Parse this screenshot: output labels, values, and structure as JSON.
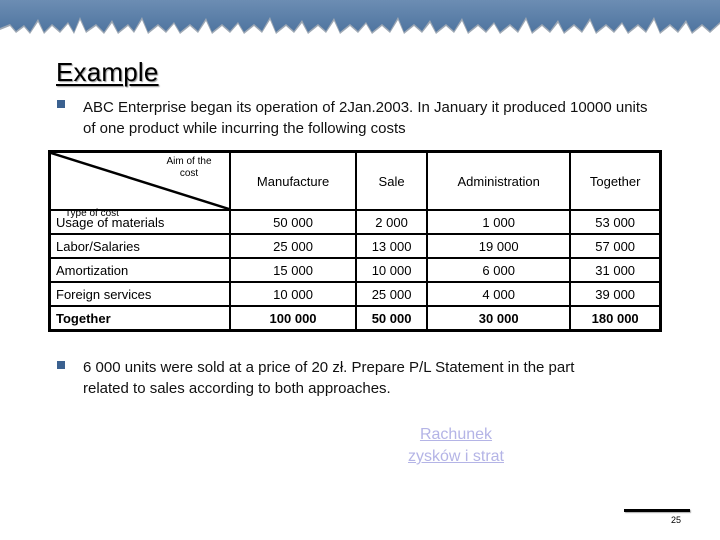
{
  "slide": {
    "title": "Example",
    "intro_text": "ABC Enterprise began its operation of 2Jan.2003. In January it produced 10000 units of one product while incurring the following costs",
    "table": {
      "corner_top_label": "Aim of the cost",
      "corner_bottom_label": "Type of cost",
      "columns": [
        "Manufacture",
        "Sale",
        "Administration",
        "Together"
      ],
      "rows": [
        {
          "label": "Usage of materials",
          "values": [
            "50 000",
            "2 000",
            "1 000",
            "53 000"
          ]
        },
        {
          "label": "Labor/Salaries",
          "values": [
            "25 000",
            "13 000",
            "19 000",
            "57 000"
          ]
        },
        {
          "label": "Amortization",
          "values": [
            "15 000",
            "10 000",
            "6 000",
            "31 000"
          ]
        },
        {
          "label": "Foreign services",
          "values": [
            "10 000",
            "25 000",
            "4 000",
            "39 000"
          ]
        },
        {
          "label": "Together",
          "values": [
            "100 000",
            "50 000",
            "30 000",
            "180 000"
          ]
        }
      ]
    },
    "task_text": "6 000 units were sold at a price of 20 zł. Prepare P/L Statement in the part related to sales according to both approaches.",
    "link_text": "Rachunek zysków i strat",
    "page_number": "25",
    "colors": {
      "banner": "#5a7fa8",
      "bullet": "#3b6190",
      "link": "#b4b4e6"
    }
  }
}
